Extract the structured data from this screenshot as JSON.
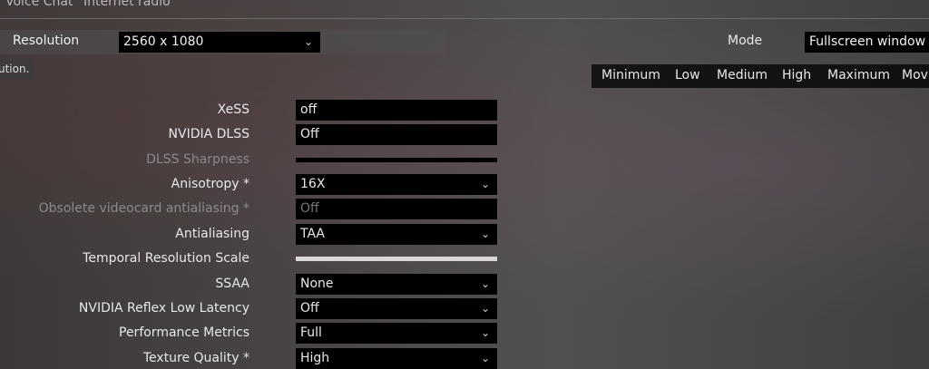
{
  "top_tabs": [
    "Voice Chat",
    "Internet radio"
  ],
  "resolution": {
    "label": "Resolution",
    "value": "2560 x 1080"
  },
  "tooltip": "ution.",
  "mode": {
    "label": "Mode",
    "value": "Fullscreen window"
  },
  "presets": [
    "Minimum",
    "Low",
    "Medium",
    "High",
    "Maximum",
    "Movi"
  ],
  "settings": [
    {
      "label": "XeSS",
      "value": "off"
    },
    {
      "label": "NVIDIA DLSS",
      "value": "Off"
    },
    {
      "label": "DLSS Sharpness",
      "value": ""
    },
    {
      "label": "Anisotropy *",
      "value": "16X"
    },
    {
      "label": "Obsolete videocard antialiasing *",
      "value": "Off"
    },
    {
      "label": "Antialiasing",
      "value": "TAA"
    },
    {
      "label": "Temporal Resolution Scale",
      "value": ""
    },
    {
      "label": "SSAA",
      "value": "None"
    },
    {
      "label": "NVIDIA Reflex Low Latency",
      "value": "Off"
    },
    {
      "label": "Performance Metrics",
      "value": "Full"
    },
    {
      "label": "Texture Quality *",
      "value": "High"
    }
  ],
  "icons": {
    "dropdown": "chevron-down-icon"
  }
}
